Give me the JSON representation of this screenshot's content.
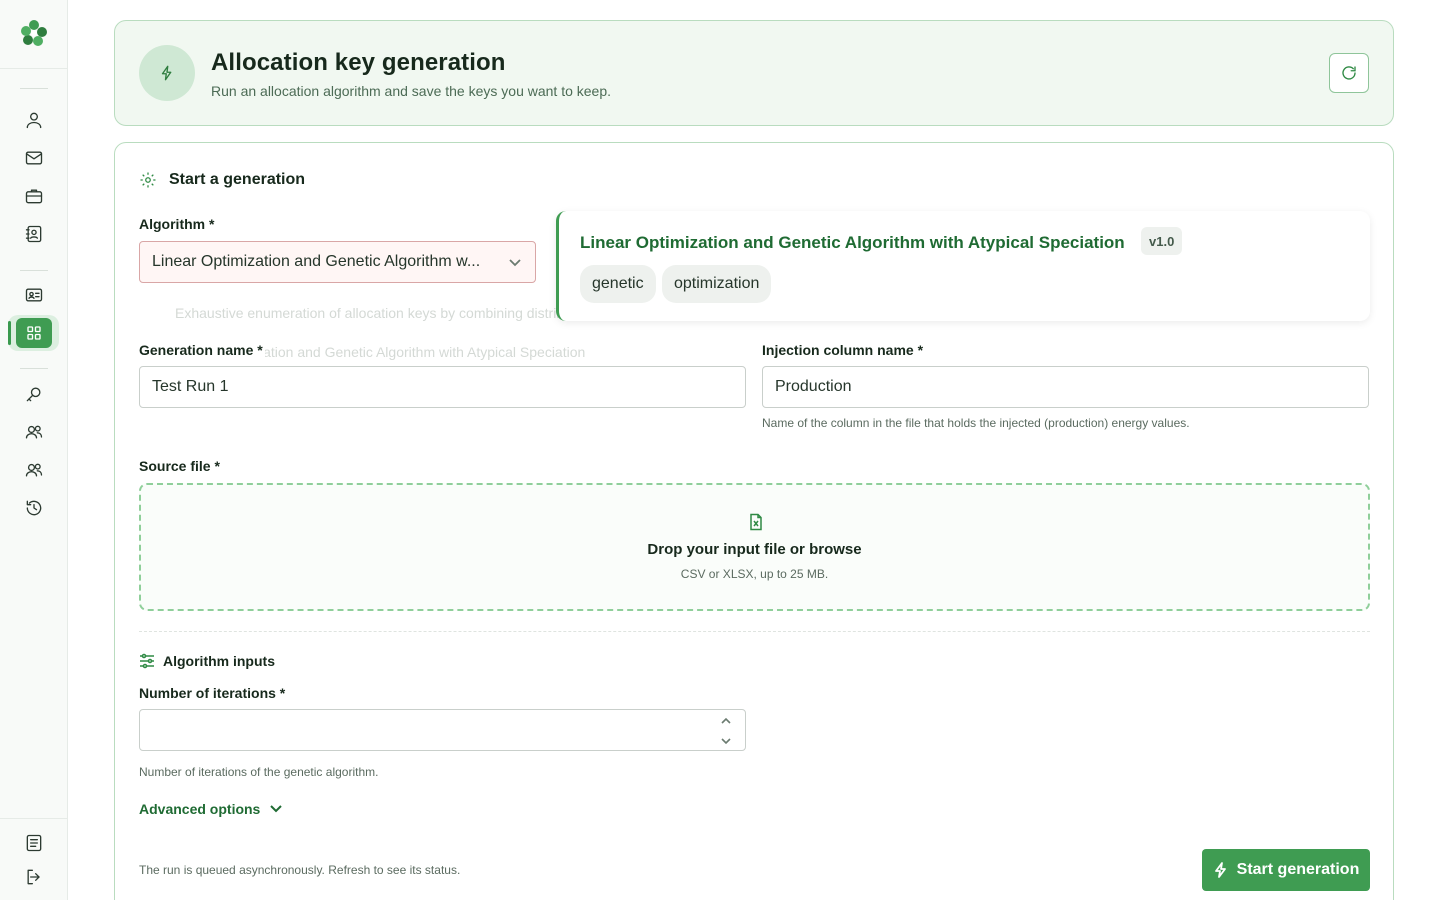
{
  "header": {
    "title": "Allocation key generation",
    "subtitle": "Run an allocation algorithm and save the keys you want to keep."
  },
  "section": {
    "title": "Start a generation"
  },
  "algorithm": {
    "label": "Algorithm *",
    "selected": "Linear Optimization and Genetic Algorithm w...",
    "ghost_description": "Exhaustive enumeration of allocation keys by combining distribution algorithms",
    "ghost_option": "ization and Genetic Algorithm with Atypical Speciation",
    "card": {
      "name": "Linear Optimization and Genetic Algorithm with Atypical Speciation",
      "version": "v1.0",
      "tags": [
        "genetic",
        "optimization"
      ]
    }
  },
  "generation_name": {
    "label": "Generation name *",
    "value": "Test Run 1"
  },
  "injection_column": {
    "label": "Injection column name *",
    "value": "Production",
    "help": "Name of the column in the file that holds the injected (production) energy values."
  },
  "source_file": {
    "label": "Source file *",
    "title": "Drop your input file or browse",
    "subtitle": "CSV or XLSX, up to 25 MB."
  },
  "algorithm_inputs": {
    "title": "Algorithm inputs",
    "iterations_label": "Number of iterations *",
    "iterations_value": "",
    "iterations_help": "Number of iterations of the genetic algorithm."
  },
  "advanced": {
    "label": "Advanced options"
  },
  "footer": {
    "note": "The run is queued asynchronously. Refresh to see its status.",
    "start_label": "Start generation"
  },
  "colors": {
    "accent": "#3f9c52",
    "accent_dark": "#1f6b33",
    "header_bg": "#f1f8f1",
    "border": "#b9dcbf"
  }
}
